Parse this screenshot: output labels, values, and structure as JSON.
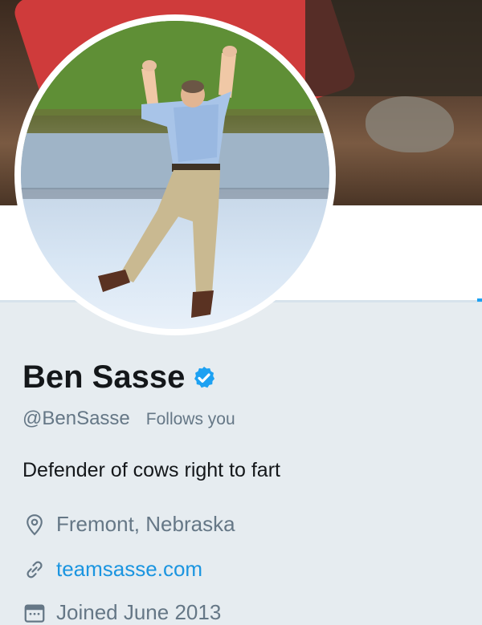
{
  "profile": {
    "name": "Ben Sasse",
    "verified": true,
    "handle": "@BenSasse",
    "follows_you": "Follows you",
    "bio": "Defender of cows right to fart",
    "location": "Fremont, Nebraska",
    "website": "teamsasse.com",
    "joined": "Joined June 2013"
  },
  "icons": {
    "verified": "verified-badge-icon",
    "location": "location-pin-icon",
    "website": "link-icon",
    "joined": "calendar-icon"
  },
  "colors": {
    "accent": "#1da1f2",
    "link": "#1b95e0",
    "secondary_text": "#657786",
    "primary_text": "#14171a",
    "background": "#e6ecf0"
  }
}
